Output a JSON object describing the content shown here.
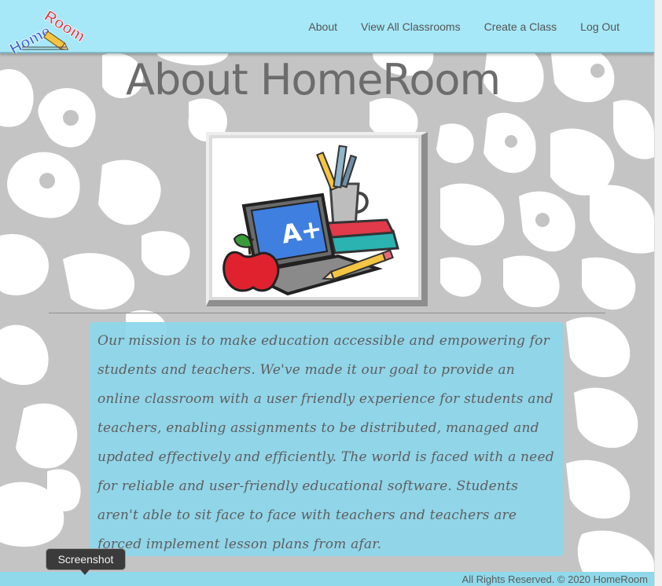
{
  "logo": {
    "text_home": "Home",
    "text_room": "Room"
  },
  "nav": {
    "about": "About",
    "view_all_classrooms": "View All Classrooms",
    "create_class": "Create a Class",
    "log_out": "Log Out"
  },
  "page": {
    "title": "About HomeRoom"
  },
  "hero": {
    "badge_text": "A+"
  },
  "mission": {
    "text": "Our mission is to make education accessible and empowering for students and teachers. We've made it our goal to provide an online classroom with a user friendly experience for students and teachers, enabling assignments to be distributed, managed and updated effectively and efficiently. The world is faced with a need for reliable and user-friendly educational software. Students aren't able to sit face to face with teachers and teachers are forced implement lesson plans from afar."
  },
  "footer": {
    "text": "All Rights Reserved. © 2020 HomeRoom"
  },
  "tooltip": {
    "text": "Screenshot"
  },
  "colors": {
    "navbar": "#a6e8f7",
    "camo_light": "#ffffff",
    "camo_dark": "#c4c4c4",
    "mission_bg": "#8cd6ea",
    "title": "#6c6c6c"
  }
}
